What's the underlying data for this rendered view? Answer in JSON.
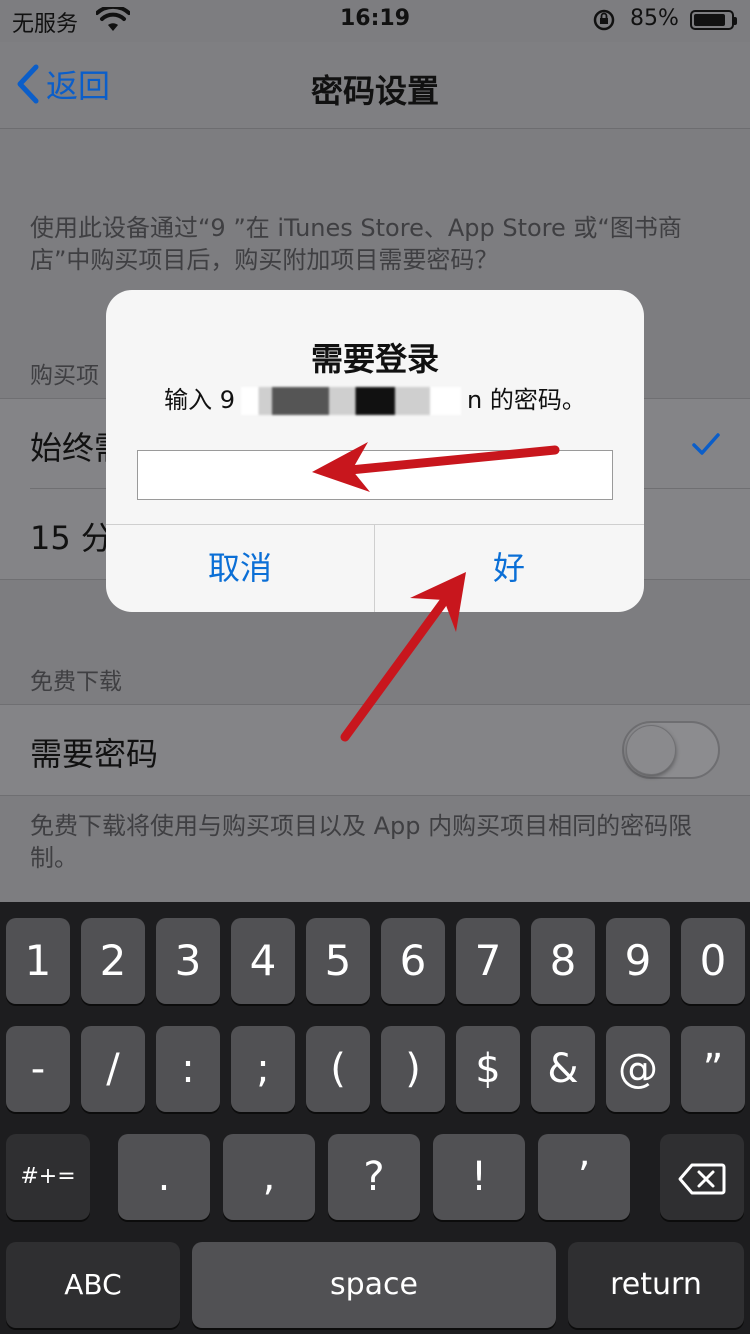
{
  "status_bar": {
    "carrier": "无服务",
    "time": "16:19",
    "battery_percent": "85%",
    "battery_level": 0.85
  },
  "nav": {
    "back_label": "返回",
    "title": "密码设置"
  },
  "description": "使用此设备通过“9                              ”在 iTunes Store、App Store 或“图书商店”中购买项目后，购买附加项目需要密码？",
  "purchases": {
    "section_label": "购买项",
    "rows": [
      {
        "label": "始终需",
        "checked": true
      },
      {
        "label": "15 分"
      }
    ]
  },
  "free_downloads": {
    "section_label": "免费下载",
    "require_password_label": "需要密码",
    "toggle_on": false,
    "footnote": "免费下载将使用与购买项目以及 App 内购买项目相同的密码限制。"
  },
  "alert": {
    "title": "需要登录",
    "message_prefix": "输入 9",
    "message_suffix": "n 的密码。",
    "input_value": "",
    "cancel_label": "取消",
    "ok_label": "好"
  },
  "keyboard": {
    "row1": [
      "1",
      "2",
      "3",
      "4",
      "5",
      "6",
      "7",
      "8",
      "9",
      "0"
    ],
    "row2": [
      "-",
      "/",
      ":",
      ";",
      "(",
      ")",
      "$",
      "&",
      "@",
      "”"
    ],
    "row3": {
      "shift": "#+=",
      "keys": [
        ".",
        ",",
        "?",
        "!",
        "’"
      ],
      "delete": "delete-icon"
    },
    "row4": {
      "abc": "ABC",
      "space": "space",
      "return": "return"
    }
  },
  "colors": {
    "accent": "#0b6fd6",
    "annotation_arrow": "#c8161d"
  }
}
